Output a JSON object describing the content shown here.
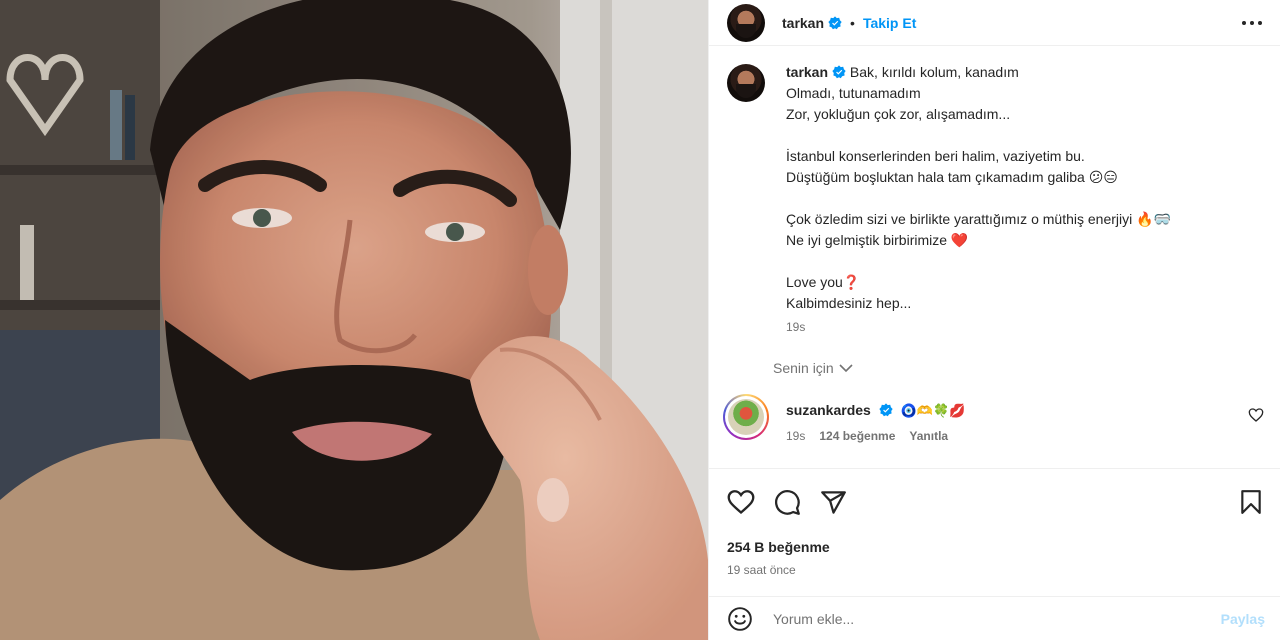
{
  "post": {
    "username": "tarkan",
    "follow_label": "Takip Et",
    "separator": "•"
  },
  "caption": {
    "username": "tarkan",
    "first_line": "Bak, kırıldı kolum, kanadım",
    "lines": [
      "Olmadı, tutunamadım",
      "Zor, yokluğun çok zor, alışamadım...",
      "",
      "İstanbul konserlerinden beri halim, vaziyetim bu.",
      "Düştüğüm boşluktan hala tam çıkamadım galiba 😕😑",
      "",
      "Çok özledim sizi ve birlikte yarattığımız o müthiş enerjiyi 🔥🥽",
      "Ne iyi gelmiştik birbirimize ❤️",
      "",
      "Love you❓",
      "Kalbimdesiniz hep..."
    ],
    "time": "19s"
  },
  "translation_toggle": "Senin için",
  "comments": [
    {
      "username": "suzankardes",
      "text": "🧿🫶🍀💋",
      "time": "19s",
      "likes": "124 beğenme",
      "reply_label": "Yanıtla"
    }
  ],
  "stats": {
    "likes": "254 B beğenme",
    "posted": "19 saat önce"
  },
  "comment_box": {
    "placeholder": "Yorum ekle...",
    "share_label": "Paylaş"
  },
  "colors": {
    "accent": "#0095f6",
    "share_disabled": "#b2dffc",
    "verified": "#0095f6",
    "heart": "#e0245e"
  },
  "icons": [
    "more-icon",
    "verified-icon",
    "chevron-down-icon",
    "heart-icon",
    "comment-icon",
    "share-icon",
    "bookmark-icon",
    "emoji-icon"
  ]
}
